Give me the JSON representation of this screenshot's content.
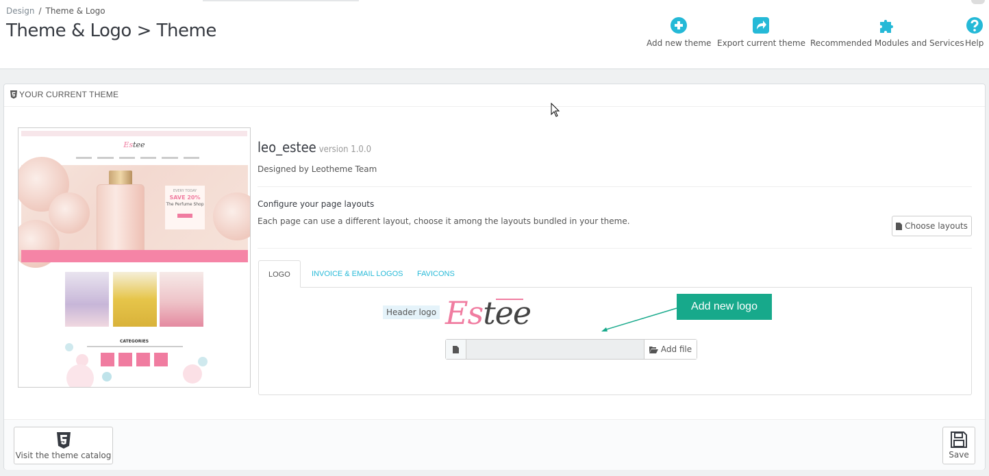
{
  "breadcrumb": {
    "parent": "Design",
    "separator": "/",
    "current": "Theme & Logo"
  },
  "page_title": "Theme & Logo > Theme",
  "toolbar": [
    {
      "label": "Add new theme",
      "icon": "plus-circle-icon"
    },
    {
      "label": "Export current theme",
      "icon": "share-icon"
    },
    {
      "label": "Recommended Modules and Services",
      "icon": "puzzle-icon"
    },
    {
      "label": "Help",
      "icon": "question-circle-icon"
    }
  ],
  "panel": {
    "heading": "YOUR CURRENT THEME",
    "heading_icon": "html5-icon"
  },
  "preview": {
    "logo_pink": "Es",
    "logo_dark": "tee",
    "card_line1": "EVERY TODAY",
    "card_line2": "SAVE 20%",
    "card_line3": "The Perfume Shop",
    "categories_title": "CATEGORIES"
  },
  "theme": {
    "name": "leo_estee",
    "version": "version 1.0.0",
    "author": "Designed by Leotheme Team"
  },
  "layouts": {
    "title": "Configure your page layouts",
    "description": "Each page can use a different layout, choose it among the layouts bundled in your theme.",
    "button": "Choose layouts"
  },
  "tabs": [
    {
      "label": "LOGO",
      "active": true
    },
    {
      "label": "INVOICE & EMAIL LOGOS",
      "active": false
    },
    {
      "label": "FAVICONS",
      "active": false
    }
  ],
  "logo_tab": {
    "header_logo_label": "Header logo",
    "logo_text_pink": "Es",
    "logo_text_dark": "tee",
    "file_input_value": "",
    "add_file_button": "Add file",
    "callout": "Add new logo"
  },
  "footer": {
    "catalog_button": "Visit the theme catalog",
    "save_button": "Save"
  },
  "colors": {
    "accent": "#25b9d7",
    "callout": "#17a98b",
    "brand_pink": "#f07ca0"
  }
}
